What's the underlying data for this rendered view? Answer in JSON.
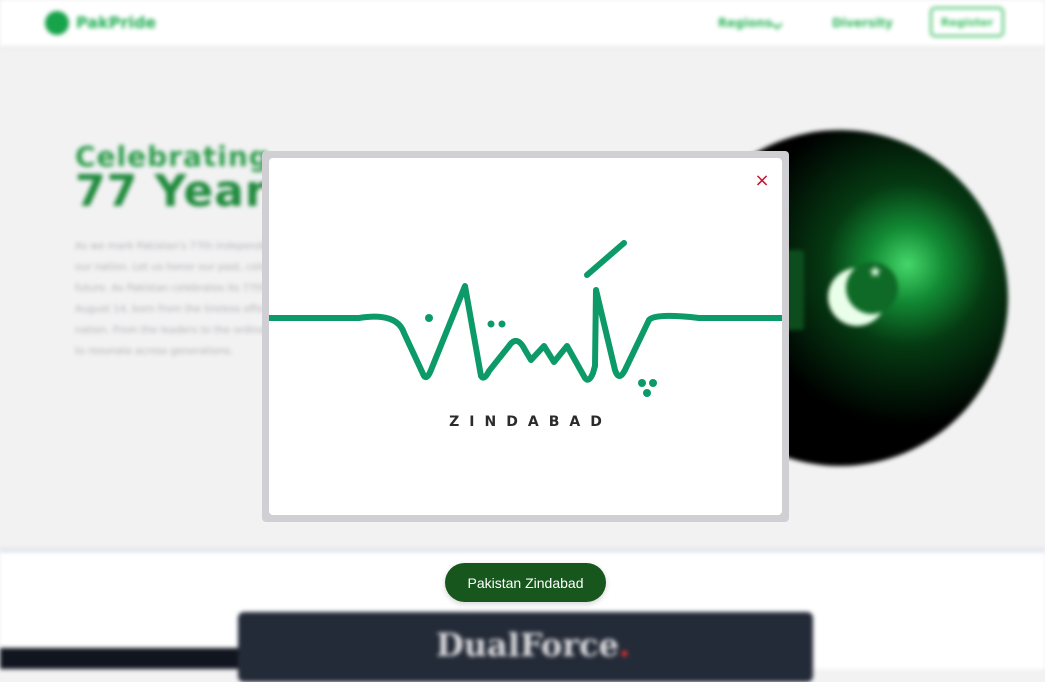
{
  "nav": {
    "brand": "PakPride",
    "links": [
      "Regions",
      "Diversity"
    ],
    "register_label": "Register"
  },
  "hero": {
    "line1": "Celebrating",
    "line2": "77 Years",
    "paragraph": "As we mark Pakistan's 77th independence, we celebrate the unity that has shaped our nation. Let us honor our past, celebrate our present, and look forward to the future. As Pakistan celebrates its 77th year, we reflect on the journey that began on August 14, born from the tireless efforts and sacrifices of a free and sovereign nation. From the leaders to the ordinary citizens, Pakistan's independence continues to resonate across generations."
  },
  "modal": {
    "close_symbol": "×",
    "caption": "ZINDABAD"
  },
  "cta": {
    "label": "Pakistan Zindabad"
  },
  "sponsor": {
    "name": "DualForce",
    "dot": "."
  },
  "colors": {
    "brand_green": "#17a34a",
    "cta_green": "#17561c",
    "art_green": "#0d9a69",
    "close_red": "#c8102e"
  }
}
